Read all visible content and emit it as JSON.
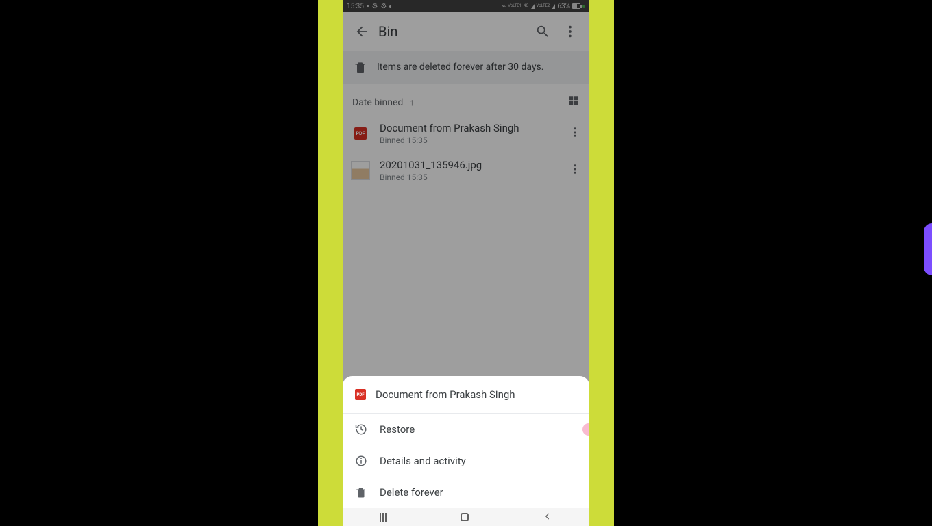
{
  "status": {
    "time": "15:35",
    "battery": "63%",
    "net1": "VoLTE1",
    "net2": "VoLTE2",
    "net_gen": "4G"
  },
  "appbar": {
    "title": "Bin"
  },
  "banner": {
    "text": "Items are deleted forever after 30 days."
  },
  "sort": {
    "label": "Date binned"
  },
  "files": [
    {
      "name": "Document from Prakash Singh",
      "meta": "Binned 15:35",
      "type": "pdf"
    },
    {
      "name": "20201031_135946.jpg",
      "meta": "Binned 15:35",
      "type": "image"
    }
  ],
  "sheet": {
    "title": "Document from Prakash Singh",
    "items": {
      "restore": "Restore",
      "details": "Details and activity",
      "delete": "Delete forever"
    }
  },
  "pdf_badge": "PDF"
}
